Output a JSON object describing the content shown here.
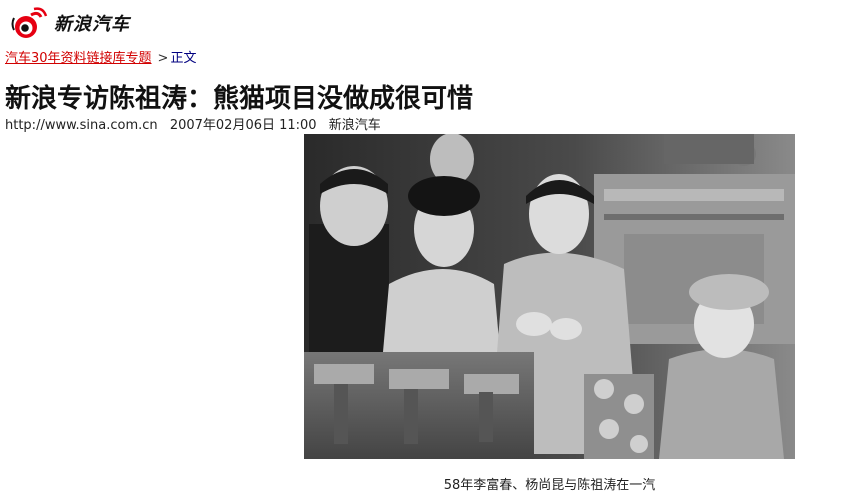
{
  "header": {
    "logo_icon": "sina-eye-logo-icon",
    "logo_text": "新浪汽车",
    "logo_color": "#e60012"
  },
  "breadcrumb": {
    "topic_link": "汽车30年资料链接库专题",
    "separator": ">",
    "current": "正文"
  },
  "article": {
    "title": "新浪专访陈祖涛：熊猫项目没做成很可惜",
    "source_url": "http://www.sina.com.cn",
    "timestamp": "2007年02月06日 11:00",
    "source_name": "新浪汽车"
  },
  "photo": {
    "style": "black-and-white historical photograph",
    "caption": "58年李富春、杨尚昆与陈祖涛在一汽"
  }
}
